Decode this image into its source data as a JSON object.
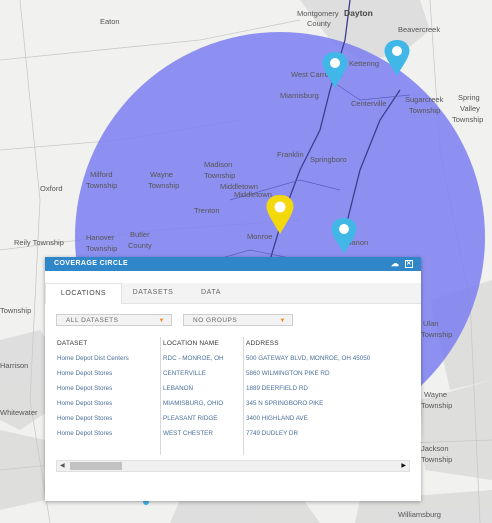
{
  "map": {
    "places": [
      "Montgomery",
      "County",
      "Dayton",
      "Eaton",
      "Beavercreek",
      "Kettering",
      "West Carrollton",
      "Miamisburg",
      "Centerville",
      "Sugarcreek",
      "Township",
      "Spring",
      "Valley",
      "Township",
      "Franklin",
      "Springboro",
      "Madison",
      "Township",
      "Wayne",
      "Township",
      "Milford",
      "Township",
      "Oxford",
      "Middletown",
      "Middletown",
      "Trenton",
      "Butler",
      "County",
      "Hanover",
      "Township",
      "Reily Township",
      "Monroe",
      "Lebanon",
      "Whitewater",
      "Harrison",
      "Township",
      "Ulan",
      "Township",
      "Wayne",
      "Township",
      "Jackson",
      "Township",
      "Williamsburg"
    ],
    "coverage_color": "#7b7ff0",
    "pins": [
      {
        "name": "map-pin-west-carrollton",
        "color": "#40b7e6"
      },
      {
        "name": "map-pin-kettering",
        "color": "#40b7e6"
      },
      {
        "name": "map-pin-monroe-selected",
        "color": "#f2d80c"
      },
      {
        "name": "map-pin-lebanon",
        "color": "#40b7e6"
      }
    ]
  },
  "popup": {
    "title": "COVERAGE CIRCLE",
    "header_color": "#2f86c8",
    "tabs": [
      "LOCATIONS",
      "DATASETS",
      "DATA"
    ],
    "active_tab": "LOCATIONS",
    "datasets_dropdown": "ALL DATASETS",
    "groups_dropdown": "NO GROUPS",
    "columns": [
      "DATASET",
      "LOCATION NAME",
      "ADDRESS"
    ],
    "rows": [
      [
        "Home Depot Dist Centers",
        "RDC - MONROE, OH",
        "500 GATEWAY BLVD, MONROE, OH 45050"
      ],
      [
        "Home Depot Stores",
        "CENTERVILLE",
        "5860 WILMINGTON PIKE RD"
      ],
      [
        "Home Depot Stores",
        "LEBANON",
        "1889 DEERFIELD RD"
      ],
      [
        "Home Depot Stores",
        "MIAMISBURG, OHIO",
        "345 N SPRINGBORO PIKE"
      ],
      [
        "Home Depot Stores",
        "PLEASANT RIDGE",
        "3400 HIGHLAND AVE"
      ],
      [
        "Home Depot Stores",
        "WEST CHESTER",
        "7749 DUDLEY DR"
      ]
    ]
  }
}
